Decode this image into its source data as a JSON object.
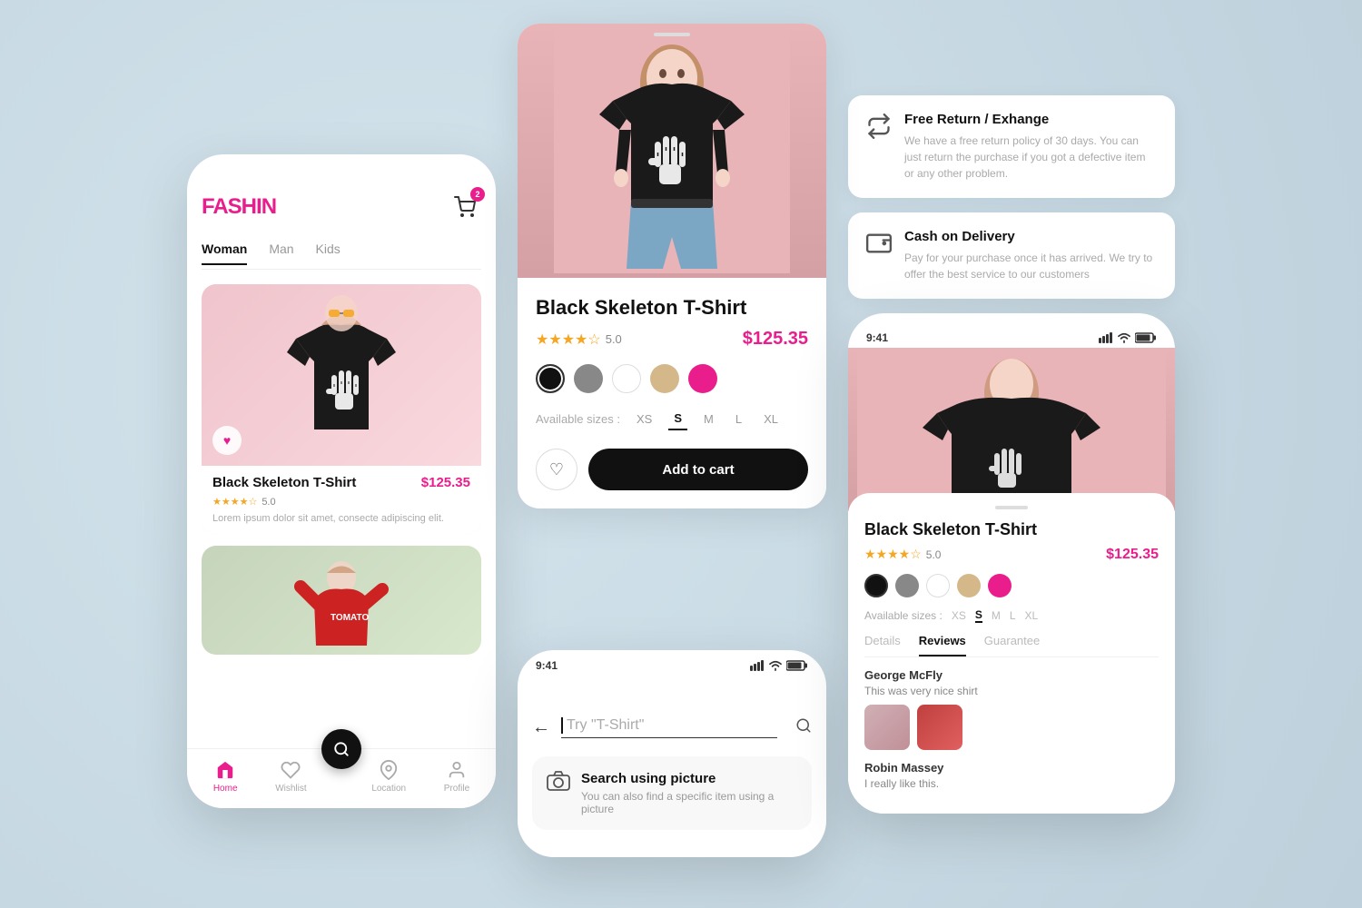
{
  "app": {
    "logo_text": "FASHI",
    "logo_accent": "N",
    "cart_badge": "2"
  },
  "phone1": {
    "nav_tabs": [
      "Woman",
      "Man",
      "Kids"
    ],
    "active_tab": "Woman",
    "product1": {
      "name": "Black Skeleton T-Shirt",
      "price": "$125.35",
      "rating": "5.0",
      "description": "Lorem ipsum dolor sit amet, consecte adipiscing elit."
    },
    "bottom_nav": [
      {
        "label": "Home",
        "active": true
      },
      {
        "label": "Wishlist",
        "active": false
      },
      {
        "label": "",
        "active": false
      },
      {
        "label": "Location",
        "active": false
      },
      {
        "label": "Profile",
        "active": false
      }
    ]
  },
  "product_detail": {
    "title": "Black Skeleton T-Shirt",
    "rating": "5.0",
    "price": "$125.35",
    "colors": [
      "#111111",
      "#888888",
      "#ffffff",
      "#d4b88a",
      "#e91e8c"
    ],
    "sizes": [
      "XS",
      "S",
      "M",
      "L",
      "XL"
    ],
    "active_size": "S",
    "add_to_cart": "Add to cart"
  },
  "search_phone": {
    "time": "9:41",
    "placeholder": "Try \"T-Shirt\"",
    "search_option_title": "Search using picture",
    "search_option_desc": "You can also find a specific item using a picture"
  },
  "features": [
    {
      "icon": "↑↓",
      "title": "Free Return / Exhange",
      "desc": "We have a free return policy of 30 days. You can just return the purchase if you got a defective item or any other problem."
    },
    {
      "icon": "💳",
      "title": "Cash on Delivery",
      "desc": "Pay for your purchase once it has arrived. We try to offer the best service to our customers"
    }
  ],
  "phone_detail_right": {
    "time": "9:41",
    "title": "Black Skeleton T-Shirt",
    "rating": "5.0",
    "price": "$125.35",
    "colors": [
      "#111111",
      "#888888",
      "#ffffff",
      "#d4b88a",
      "#e91e8c"
    ],
    "sizes": [
      "XS",
      "S",
      "M",
      "L",
      "XL"
    ],
    "active_size": "S",
    "tabs": [
      "Details",
      "Reviews",
      "Guarantee"
    ],
    "active_tab": "Reviews",
    "reviews": [
      {
        "name": "George McFly",
        "comment": "This was very nice shirt"
      },
      {
        "name": "Robin Massey",
        "comment": "I really like this."
      }
    ]
  }
}
